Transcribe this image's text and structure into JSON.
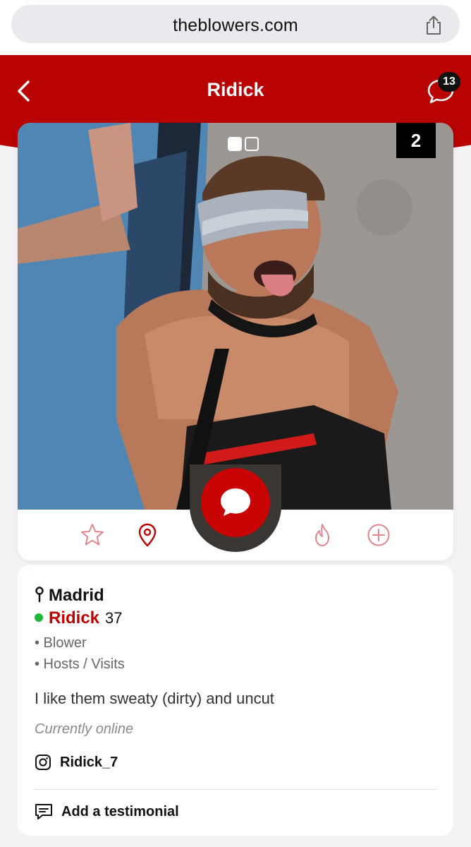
{
  "browser": {
    "url": "theblowers.com",
    "icons": {
      "share": "share-icon"
    }
  },
  "header": {
    "title": "Ridick",
    "unread_count": "13",
    "icons": {
      "back": "chevron-left-icon",
      "chat": "chat-bubble-icon"
    },
    "color": "#b90202"
  },
  "photo": {
    "pages": 2,
    "current_page": 1,
    "count_label": "2",
    "description": "profile-photo"
  },
  "actions": [
    {
      "name": "favorite",
      "icon": "star-icon"
    },
    {
      "name": "location",
      "icon": "map-pin-icon"
    },
    {
      "name": "message",
      "icon": "chat-bubble-icon"
    },
    {
      "name": "hot",
      "icon": "flame-icon"
    },
    {
      "name": "add",
      "icon": "plus-circle-icon"
    }
  ],
  "profile": {
    "city": "Madrid",
    "name": "Ridick",
    "age": "37",
    "tags": [
      "• Blower",
      "• Hosts / Visits"
    ],
    "bio": "I like them sweaty (dirty) and uncut",
    "status": "Currently online",
    "instagram": "Ridick_7",
    "testimonial_label": "Add a testimonial"
  },
  "colors": {
    "accent": "#c00000",
    "online": "#1fb736"
  }
}
